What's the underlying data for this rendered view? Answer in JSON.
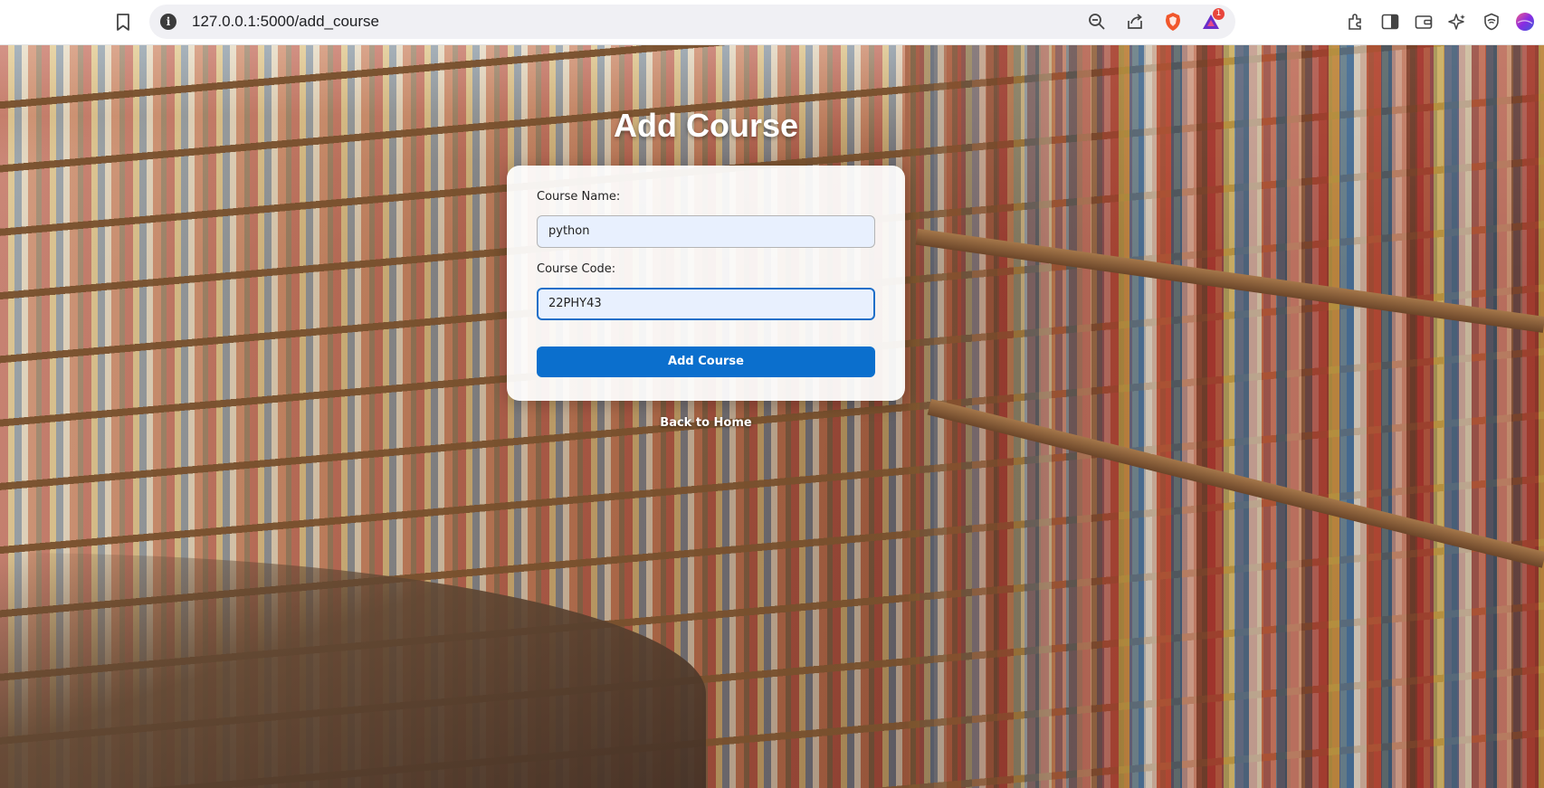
{
  "browser": {
    "url": "127.0.0.1:5000/add_course",
    "notification_badge": "1",
    "icons": [
      "bookmark-icon",
      "site-info-icon",
      "zoom-out-icon",
      "share-icon",
      "brave-shield-icon",
      "brave-rewards-icon",
      "extensions-icon",
      "sidebar-icon",
      "wallet-icon",
      "leo-ai-icon",
      "vpn-icon",
      "profile-avatar-icon"
    ]
  },
  "page": {
    "title": "Add Course",
    "form": {
      "course_name_label": "Course Name:",
      "course_name_value": "python",
      "course_code_label": "Course Code:",
      "course_code_value": "22PHY43",
      "submit_label": "Add Course"
    },
    "back_link": "Back to Home"
  },
  "colors": {
    "button": "#0b6fcd",
    "input_bg": "#e8f0fe",
    "focus_border": "#1f6fc8"
  }
}
